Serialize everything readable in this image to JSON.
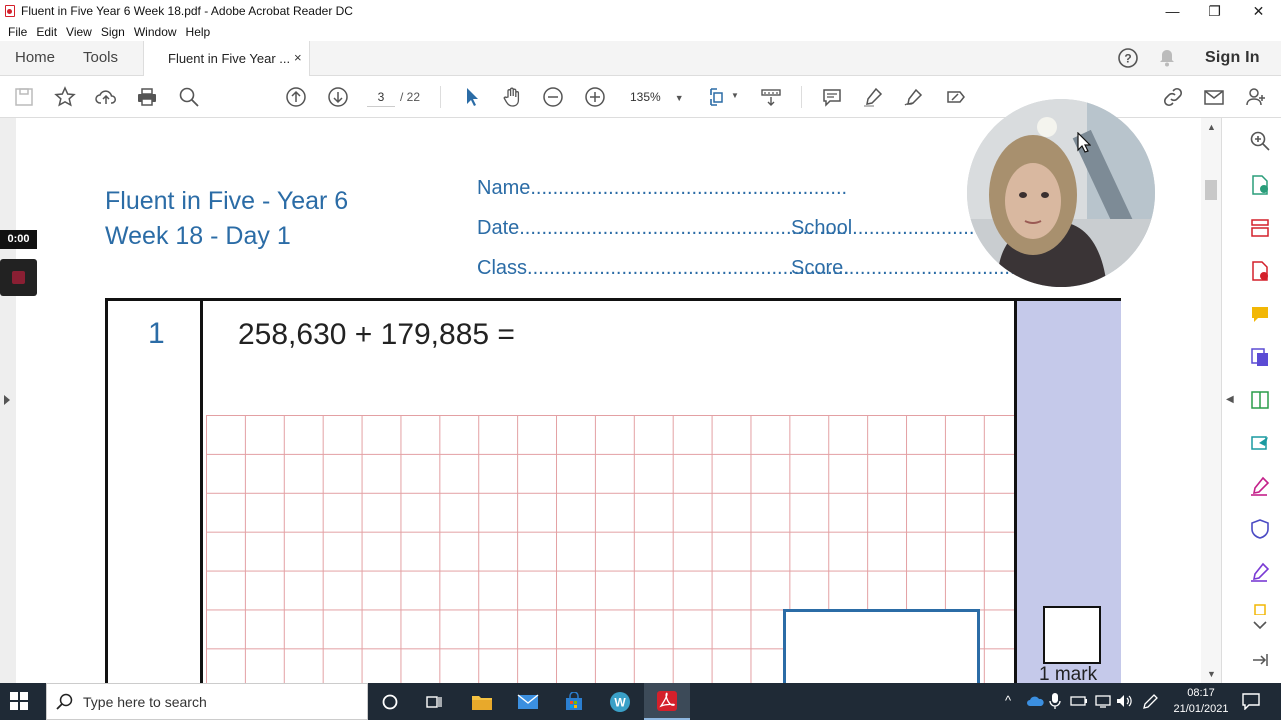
{
  "window": {
    "title": "Fluent in Five Year 6 Week 18.pdf - Adobe Acrobat Reader DC",
    "minimize": "—",
    "maximize": "❐",
    "close": "✕"
  },
  "menu": [
    "File",
    "Edit",
    "View",
    "Sign",
    "Window",
    "Help"
  ],
  "tabs": {
    "home": "Home",
    "tools": "Tools",
    "doc": "Fluent in Five Year ...",
    "close": "×"
  },
  "header": {
    "sign_in": "Sign In"
  },
  "toolbar": {
    "page_current": "3",
    "page_total": "/ 22",
    "zoom": "135%"
  },
  "document": {
    "title_line1": "Fluent in Five - Year 6",
    "title_line2": "Week 18 - Day 1",
    "name_field": "Name.........................................................",
    "date_field": "Date...........................................................",
    "school_field": "School.......................",
    "class_field": "Class..........................................................",
    "score_field": "Score.....................................",
    "question_number": "1",
    "question_text": "258,630 + 179,885 =",
    "mark_label": "1 mark"
  },
  "recording": {
    "timer": "0:00"
  },
  "taskbar": {
    "search_placeholder": "Type here to search",
    "time": "08:17",
    "date": "21/01/2021"
  },
  "colors": {
    "accent_blue": "#2b6ca6",
    "mark_column": "#c5c9ea",
    "grid_red": "#e3a0a3",
    "acrobat_red": "#d4202b"
  }
}
